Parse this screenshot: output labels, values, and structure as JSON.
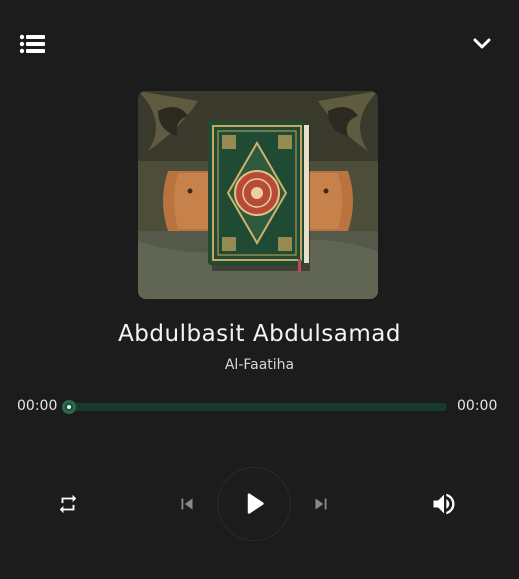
{
  "header": {
    "playlist_icon": "list-icon",
    "collapse_icon": "chevron-down-icon"
  },
  "cover": {
    "description_icon": "quran-cover-art"
  },
  "track": {
    "reciter": "Abdulbasit Abdulsamad",
    "surah": "Al-Faatiha"
  },
  "progress": {
    "current_time": "00:00",
    "total_time": "00:00",
    "fraction": 0.0
  },
  "controls": {
    "repeat_icon": "repeat-icon",
    "previous_icon": "skip-previous-icon",
    "play_icon": "play-icon",
    "next_icon": "skip-next-icon",
    "volume_icon": "volume-up-icon"
  },
  "colors": {
    "background": "#1c1c1c",
    "accent": "#2f9a66",
    "track": "#173a2e",
    "text": "#f4f4f4"
  }
}
